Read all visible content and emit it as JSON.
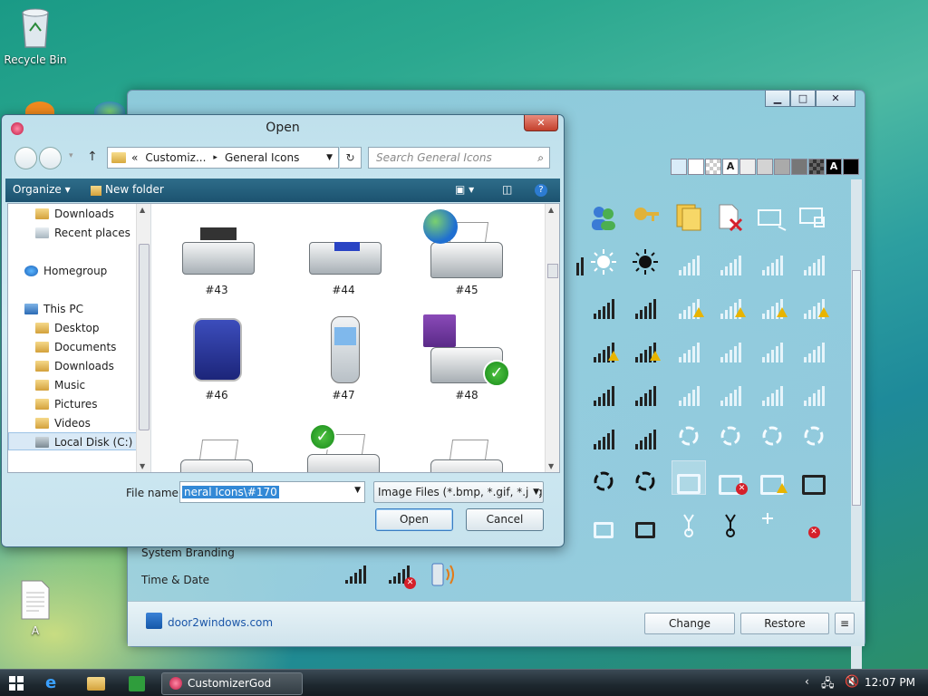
{
  "desktop": {
    "recycle_bin": "Recycle Bin",
    "file_a": "A"
  },
  "cg_window": {
    "rows": [
      "System Branding",
      "Time & Date"
    ],
    "footer_link": "door2windows.com",
    "change_label": "Change",
    "restore_label": "Restore",
    "menu_label": "≡",
    "swatch_label_a": "A"
  },
  "open_dialog": {
    "title": "Open",
    "close_label": "✕",
    "address": {
      "prefix": "«",
      "part1": "Customiz...",
      "sep": "▸",
      "part2": "General Icons"
    },
    "search_placeholder": "Search General Icons",
    "toolbar": {
      "organize": "Organize ▾",
      "new_folder": "New folder"
    },
    "nav_items": [
      {
        "label": "Downloads"
      },
      {
        "label": "Recent places"
      },
      {
        "label": "Homegroup"
      },
      {
        "label": "This PC"
      },
      {
        "label": "Desktop"
      },
      {
        "label": "Documents"
      },
      {
        "label": "Downloads"
      },
      {
        "label": "Music"
      },
      {
        "label": "Pictures"
      },
      {
        "label": "Videos"
      },
      {
        "label": "Local Disk (C:)"
      }
    ],
    "files": [
      {
        "name": "#43"
      },
      {
        "name": "#44"
      },
      {
        "name": "#45"
      },
      {
        "name": "#46"
      },
      {
        "name": "#47"
      },
      {
        "name": "#48"
      }
    ],
    "filename_label": "File name:",
    "filename_value": "neral Icons\\#170",
    "filetype_value": "Image Files (*.bmp, *.gif, *.jpg,",
    "open_label": "Open",
    "cancel_label": "Cancel"
  },
  "taskbar": {
    "app_label": "CustomizerGod",
    "time": "12:07 PM"
  }
}
